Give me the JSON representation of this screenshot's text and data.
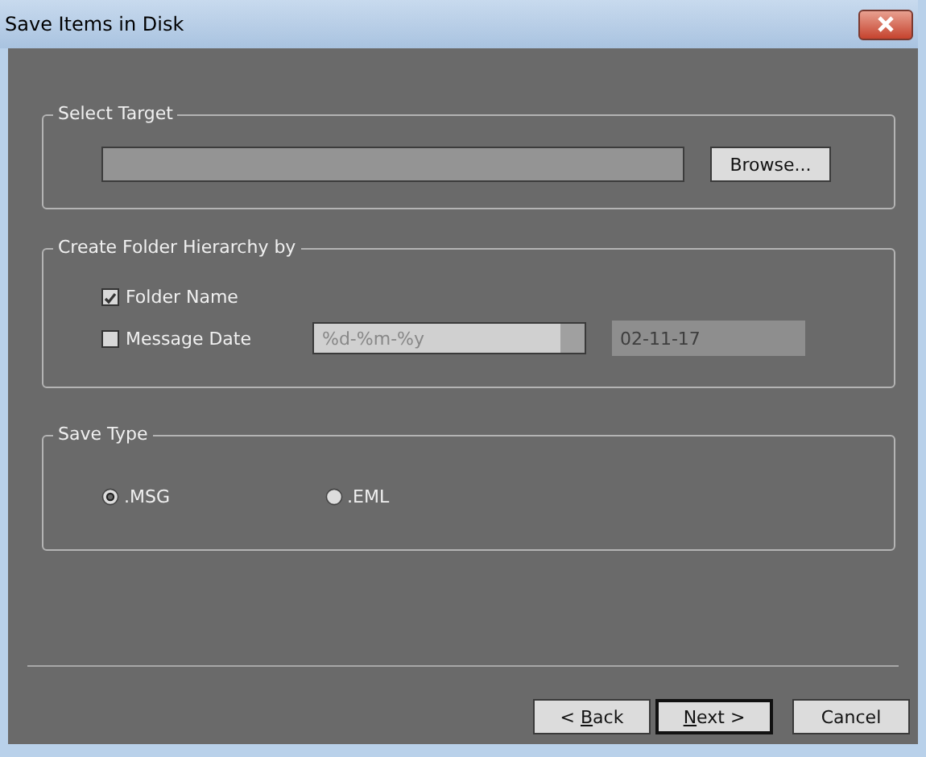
{
  "window": {
    "title": "Save Items in Disk"
  },
  "select_target": {
    "title": "Select Target",
    "browse_button": "Browse..."
  },
  "folder_hierarchy": {
    "title": "Create Folder Hierarchy by",
    "options": [
      {
        "label": "Folder Name",
        "checked": true
      },
      {
        "label": "Message Date",
        "checked": false
      }
    ],
    "date_format": {
      "value": "%d-%m-%y",
      "disabled": true
    },
    "date_preview": {
      "value": "02-11-17",
      "disabled": true
    }
  },
  "save_type": {
    "title": "Save Type",
    "options": [
      {
        "label": ".MSG",
        "selected": true
      },
      {
        "label": ".EML",
        "selected": false
      }
    ]
  },
  "buttons": [
    {
      "label": "< Back",
      "default": false
    },
    {
      "label": "Next >",
      "default": true
    },
    {
      "label": "Cancel",
      "default": false
    }
  ]
}
